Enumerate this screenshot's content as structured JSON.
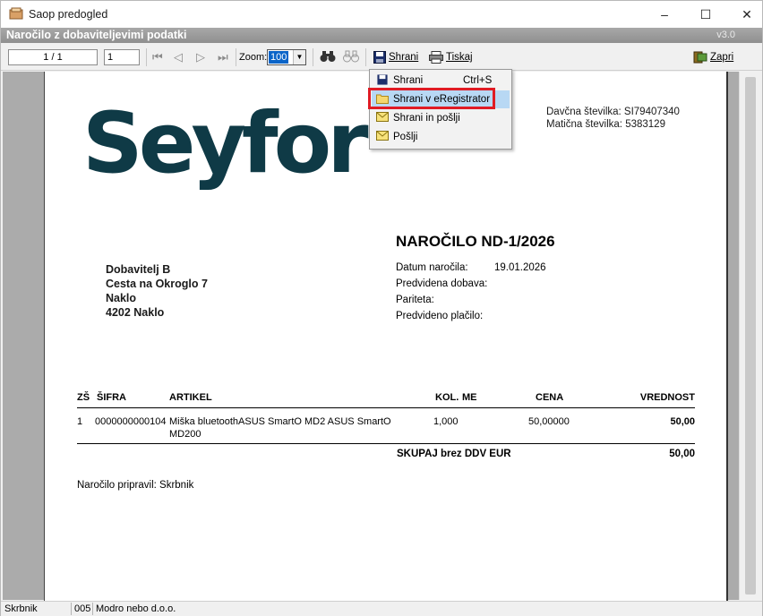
{
  "window": {
    "title": "Saop predogled",
    "min": "–",
    "max": "☐",
    "close": "✕"
  },
  "header": {
    "title": "Naročilo z dobaviteljevimi podatki",
    "version": "v3.0"
  },
  "toolbar": {
    "page_indicator": "1 / 1",
    "page_input": "1",
    "zoom_label": "Zoom:",
    "zoom_value": "100",
    "save_label": "Shrani",
    "print_label": "Tiskaj",
    "close_label": "Zapri"
  },
  "menu": {
    "items": [
      {
        "label": "Shrani",
        "shortcut": "Ctrl+S"
      },
      {
        "label": "Shrani v eRegistrator",
        "shortcut": ""
      },
      {
        "label": "Shrani in pošlji",
        "shortcut": ""
      },
      {
        "label": "Pošlji",
        "shortcut": ""
      }
    ]
  },
  "document": {
    "logo_text": "Seyfor",
    "tax_number": "Davčna številka: SI79407340",
    "registration_number": "Matična številka: 5383129",
    "order_title": "NAROČILO ND-1/2026",
    "supplier": {
      "name": "Dobavitelj B",
      "street": "Cesta na Okroglo 7",
      "city": "Naklo",
      "postal": "4202 Naklo"
    },
    "meta": [
      {
        "label": "Datum naročila:",
        "value": "19.01.2026"
      },
      {
        "label": "Predvidena dobava:",
        "value": ""
      },
      {
        "label": "Pariteta:",
        "value": ""
      },
      {
        "label": "Predvideno plačilo:",
        "value": ""
      }
    ],
    "table": {
      "headers": {
        "zs": "ZŠ",
        "sifra": "ŠIFRA",
        "artikel": "ARTIKEL",
        "kol": "KOL.",
        "me": "ME",
        "cena": "CENA",
        "vrednost": "VREDNOST"
      },
      "rows": [
        {
          "zs": "1",
          "sifra": "0000000000104",
          "artikel": "Miška bluetoothASUS SmartO MD2 ASUS SmartO MD200",
          "kol": "1,000",
          "me": "",
          "cena": "50,00000",
          "vrednost": "50,00"
        }
      ],
      "total_label": "SKUPAJ brez DDV EUR",
      "total_value": "50,00"
    },
    "prepared_by": "Naročilo pripravil: Skrbnik"
  },
  "status": {
    "user": "Skrbnik",
    "code": "005",
    "company": "Modro nebo d.o.o."
  }
}
